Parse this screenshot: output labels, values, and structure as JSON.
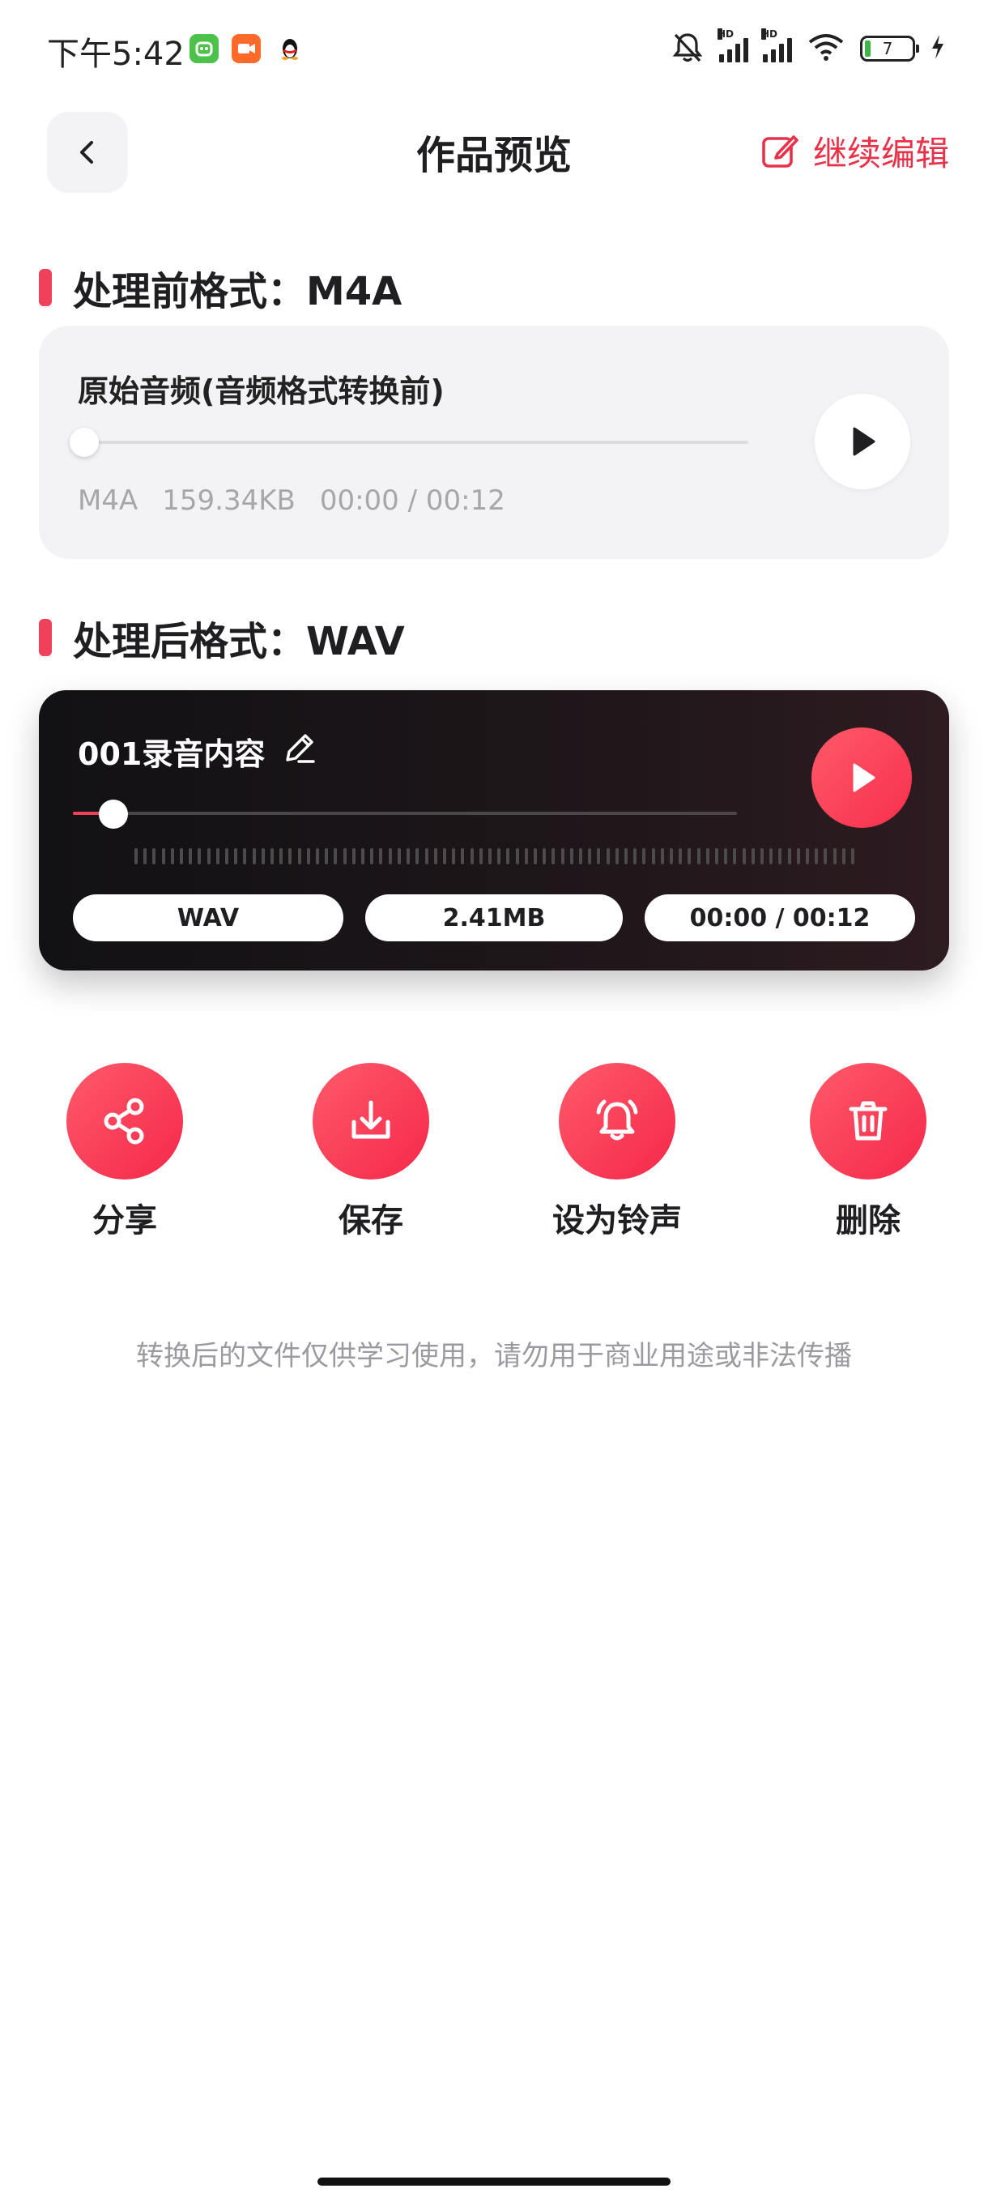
{
  "status_bar": {
    "time": "下午5:42",
    "signal_hd_1": "HD",
    "signal_hd_2": "HD",
    "battery_level": "7",
    "icons": [
      "app-green-icon",
      "video-app-icon",
      "qq-penguin-icon",
      "mute-bell-icon",
      "signal-icon",
      "wifi-icon",
      "battery-icon",
      "charging-icon"
    ]
  },
  "header": {
    "title": "作品预览",
    "edit_label": "继续编辑"
  },
  "before": {
    "section_title": "处理前格式：M4A",
    "card_title": "原始音频(音频格式转换前)",
    "format": "M4A",
    "size": "159.34KB",
    "time": "00:00 / 00:12"
  },
  "after": {
    "section_title": "处理后格式：WAV",
    "name": "001录音内容",
    "format": "WAV",
    "size": "2.41MB",
    "time": "00:00 / 00:12"
  },
  "actions": [
    {
      "label": "分享",
      "icon": "share-icon"
    },
    {
      "label": "保存",
      "icon": "download-icon"
    },
    {
      "label": "设为铃声",
      "icon": "ringtone-bell-icon"
    },
    {
      "label": "删除",
      "icon": "trash-icon"
    }
  ],
  "notice": "转换后的文件仅供学习使用，请勿用于商业用途或非法传播",
  "colors": {
    "accent": "#f0415a",
    "card_dark": "#1d1619",
    "card_light": "#f3f3f5"
  }
}
